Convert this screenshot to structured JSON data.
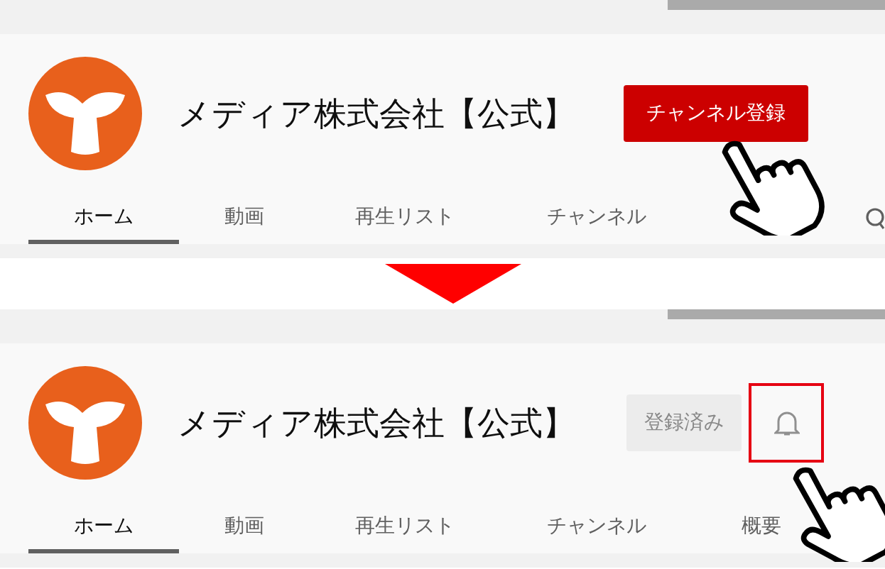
{
  "panels": [
    {
      "channel_name": "メディア株式会社【公式】",
      "subscribe": {
        "kind": "subscribe",
        "label": "チャンネル登録"
      },
      "tabs": [
        {
          "label": "ホーム",
          "selected": true
        },
        {
          "label": "動画",
          "selected": false
        },
        {
          "label": "再生リスト",
          "selected": false
        },
        {
          "label": "チャンネル",
          "selected": false
        }
      ],
      "search_icon": true
    },
    {
      "channel_name": "メディア株式会社【公式】",
      "subscribe": {
        "kind": "subscribed",
        "label": "登録済み",
        "bell_highlighted": true
      },
      "tabs": [
        {
          "label": "ホーム",
          "selected": true
        },
        {
          "label": "動画",
          "selected": false
        },
        {
          "label": "再生リスト",
          "selected": false
        },
        {
          "label": "チャンネル",
          "selected": false
        },
        {
          "label": "概要",
          "selected": false
        }
      ]
    }
  ]
}
